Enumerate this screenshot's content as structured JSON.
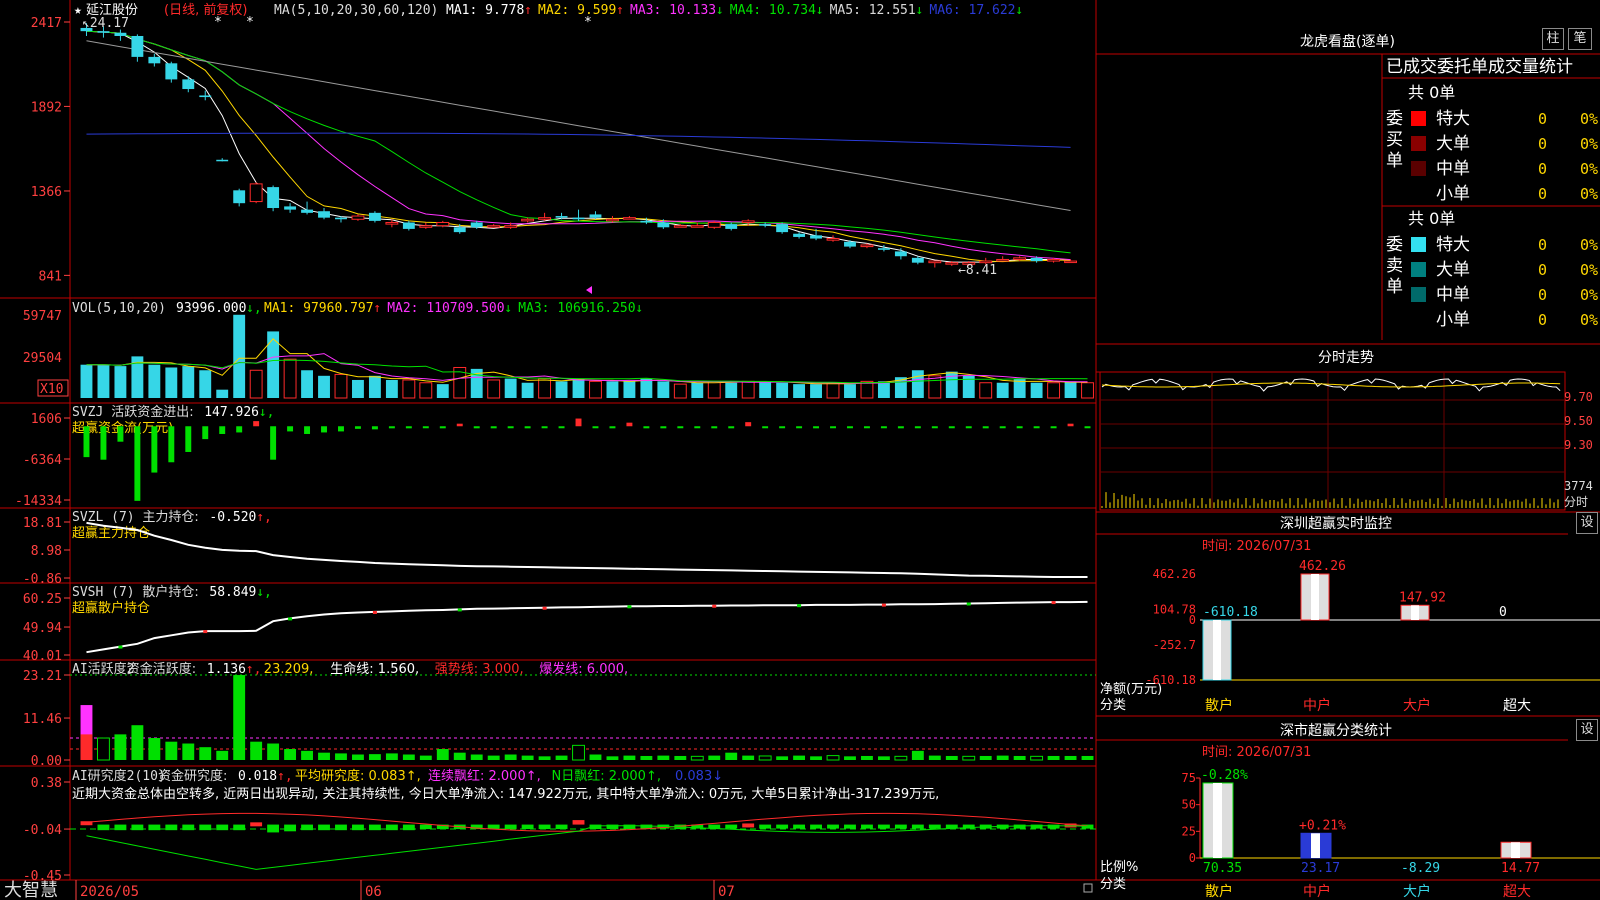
{
  "app": {
    "footer_brand": "大智慧",
    "dates": [
      "2026/05",
      "06",
      "07"
    ]
  },
  "colors": {
    "up": "#ff2a2a",
    "down": "#36d6e7",
    "grid": "#c00000",
    "axis": "#ff4040",
    "green": "#00e000",
    "yellow": "#ffd700",
    "magenta": "#ff33ff",
    "white": "#ffffff",
    "gray": "#9a9a9a",
    "blue": "#2a3bd6"
  },
  "chart_data": [
    {
      "id": "price",
      "type": "candlestick",
      "title": "延江股份",
      "subtitle": "(日线, 前复权)",
      "ma_header": "MA(5,10,20,30,60,120)",
      "ma_values": [
        {
          "label": "MA1:",
          "value": "9.778",
          "arrow": "↑",
          "color": "#ffffff"
        },
        {
          "label": "MA2:",
          "value": "9.599",
          "arrow": "↑",
          "color": "#ffd700"
        },
        {
          "label": "MA3:",
          "value": "10.133",
          "arrow": "↓",
          "color": "#ff33ff"
        },
        {
          "label": "MA4:",
          "value": "10.734",
          "arrow": "↓",
          "color": "#00e000"
        },
        {
          "label": "MA5:",
          "value": "12.551",
          "arrow": "↓",
          "color": "#d8d8d8"
        },
        {
          "label": "MA6:",
          "value": "17.622",
          "arrow": "↓",
          "color": "#2a3bd6"
        }
      ],
      "y_ticks": [
        "2417",
        "1892",
        "1366",
        "841"
      ],
      "ylim": [
        750,
        2417
      ],
      "high_label": "24.17",
      "low_label": "←8.41",
      "candles": [
        [
          2380,
          2360,
          2410,
          2330
        ],
        [
          2360,
          2350,
          2390,
          2320
        ],
        [
          2350,
          2330,
          2370,
          2300
        ],
        [
          2330,
          2200,
          2340,
          2170
        ],
        [
          2200,
          2160,
          2220,
          2140
        ],
        [
          2160,
          2060,
          2170,
          2040
        ],
        [
          2060,
          2000,
          2080,
          1980
        ],
        [
          1960,
          1950,
          1990,
          1930
        ],
        [
          1560,
          1555,
          1570,
          1550
        ],
        [
          1370,
          1290,
          1380,
          1270
        ],
        [
          1300,
          1410,
          1420,
          1290
        ],
        [
          1390,
          1260,
          1400,
          1240
        ],
        [
          1270,
          1250,
          1290,
          1230
        ],
        [
          1250,
          1230,
          1300,
          1220
        ],
        [
          1240,
          1200,
          1260,
          1190
        ],
        [
          1200,
          1190,
          1210,
          1170
        ],
        [
          1190,
          1210,
          1220,
          1180
        ],
        [
          1230,
          1180,
          1240,
          1170
        ],
        [
          1160,
          1170,
          1190,
          1140
        ],
        [
          1170,
          1130,
          1180,
          1120
        ],
        [
          1140,
          1150,
          1170,
          1130
        ],
        [
          1150,
          1170,
          1180,
          1140
        ],
        [
          1140,
          1110,
          1160,
          1100
        ],
        [
          1170,
          1140,
          1180,
          1130
        ],
        [
          1150,
          1150,
          1160,
          1140
        ],
        [
          1140,
          1150,
          1170,
          1130
        ],
        [
          1180,
          1190,
          1200,
          1170
        ],
        [
          1190,
          1200,
          1230,
          1180
        ],
        [
          1210,
          1200,
          1230,
          1190
        ],
        [
          1200,
          1190,
          1250,
          1180
        ],
        [
          1220,
          1200,
          1240,
          1190
        ],
        [
          1180,
          1190,
          1210,
          1170
        ],
        [
          1200,
          1200,
          1210,
          1190
        ],
        [
          1180,
          1170,
          1200,
          1160
        ],
        [
          1170,
          1140,
          1190,
          1130
        ],
        [
          1150,
          1150,
          1160,
          1140
        ],
        [
          1150,
          1150,
          1170,
          1140
        ],
        [
          1140,
          1170,
          1180,
          1130
        ],
        [
          1160,
          1130,
          1170,
          1120
        ],
        [
          1170,
          1180,
          1190,
          1150
        ],
        [
          1160,
          1150,
          1170,
          1140
        ],
        [
          1160,
          1110,
          1170,
          1100
        ],
        [
          1100,
          1080,
          1110,
          1070
        ],
        [
          1090,
          1070,
          1130,
          1060
        ],
        [
          1060,
          1070,
          1090,
          1050
        ],
        [
          1050,
          1020,
          1060,
          1010
        ],
        [
          1020,
          1030,
          1040,
          1010
        ],
        [
          1010,
          1000,
          1030,
          990
        ],
        [
          990,
          960,
          1010,
          940
        ],
        [
          950,
          920,
          960,
          910
        ],
        [
          920,
          930,
          930,
          890
        ],
        [
          920,
          920,
          930,
          900
        ],
        [
          910,
          920,
          930,
          900
        ],
        [
          920,
          930,
          950,
          910
        ],
        [
          940,
          940,
          960,
          930
        ],
        [
          940,
          950,
          960,
          930
        ],
        [
          950,
          930,
          960,
          920
        ],
        [
          930,
          940,
          950,
          920
        ],
        [
          930,
          930,
          940,
          920
        ]
      ]
    },
    {
      "id": "volume",
      "type": "bar",
      "header": "VOL(5,10,20)",
      "current": "93996.000",
      "current_arrow": "↓,",
      "ma": [
        {
          "label": "MA1:",
          "value": "97960.797",
          "arrow": "↑",
          "color": "#ffd700"
        },
        {
          "label": "MA2:",
          "value": "110709.500",
          "arrow": "↓",
          "color": "#ff33ff"
        },
        {
          "label": "MA3:",
          "value": "106916.250",
          "arrow": "↓",
          "color": "#00e000"
        }
      ],
      "y_ticks": [
        "59747",
        "29504"
      ],
      "unit_label": "X10",
      "ylim": [
        0,
        62000
      ],
      "values": [
        24000,
        24000,
        23000,
        30000,
        24000,
        22000,
        23000,
        20000,
        6000,
        60000,
        20000,
        48000,
        28000,
        20000,
        16000,
        17000,
        13000,
        16000,
        13000,
        13000,
        11000,
        10000,
        22000,
        21000,
        13000,
        14000,
        11000,
        14000,
        12000,
        14000,
        12000,
        12000,
        12000,
        14000,
        12000,
        10000,
        11000,
        12000,
        11000,
        12000,
        12000,
        11000,
        10000,
        10000,
        11000,
        10000,
        12000,
        12000,
        15000,
        20000,
        16000,
        19000,
        16000,
        11000,
        11000,
        14000,
        11000,
        11000,
        12000,
        11000
      ],
      "up": [
        false,
        false,
        false,
        false,
        false,
        false,
        false,
        false,
        false,
        false,
        true,
        false,
        true,
        false,
        false,
        true,
        false,
        false,
        false,
        true,
        true,
        false,
        true,
        false,
        true,
        false,
        false,
        true,
        false,
        false,
        true,
        false,
        false,
        false,
        false,
        true,
        false,
        true,
        false,
        true,
        false,
        false,
        false,
        false,
        true,
        false,
        true,
        false,
        false,
        false,
        true,
        false,
        false,
        true,
        false,
        false,
        false,
        true,
        false,
        true
      ]
    },
    {
      "id": "svzj",
      "type": "bar",
      "header": "SVZJ",
      "label": "活跃资金进出:",
      "current": "147.926",
      "current_arrow": "↓,",
      "sub_label": "超赢资金流(万元)",
      "y_ticks": [
        "1606",
        "-6364",
        "-14334"
      ],
      "ylim": [
        -14334,
        1606
      ],
      "values": [
        -6000,
        -6500,
        -3000,
        -14500,
        -9000,
        -7000,
        -5000,
        -2500,
        -1500,
        -1200,
        1000,
        -6500,
        -1000,
        -1500,
        -1200,
        -1000,
        -500,
        -600,
        -400,
        -400,
        -300,
        -400,
        500,
        -400,
        -400,
        -300,
        -400,
        -300,
        -300,
        1500,
        -300,
        -400,
        700,
        -400,
        -400,
        -300,
        -300,
        -400,
        -400,
        800,
        -300,
        -300,
        -300,
        -400,
        -300,
        -300,
        -300,
        -300,
        -400,
        -300,
        -300,
        -300,
        -300,
        -400,
        -300,
        -300,
        -300,
        -300,
        500,
        -300
      ]
    },
    {
      "id": "svzl",
      "type": "line",
      "header": "SVZL (7)",
      "label": "主力持仓:",
      "current": "-0.520",
      "current_arrow": "↑,",
      "sub_label": "超赢主力持仓",
      "y_ticks": [
        "18.81",
        "8.98",
        "-0.86"
      ],
      "ylim": [
        -0.86,
        18.81
      ],
      "values": [
        18.5,
        17.5,
        16.8,
        16,
        14,
        12.5,
        10.8,
        9.8,
        9,
        8.7,
        8.6,
        7.2,
        6.5,
        5.9,
        5.5,
        5.1,
        4.8,
        4.4,
        4.2,
        4.0,
        3.8,
        3.6,
        3.4,
        3.3,
        3.2,
        3.1,
        3.0,
        2.9,
        2.8,
        2.7,
        2.6,
        2.5,
        2.4,
        2.3,
        2.2,
        2.1,
        2.0,
        1.9,
        1.8,
        1.7,
        1.6,
        1.5,
        1.4,
        1.3,
        1.2,
        1.1,
        1.0,
        0.9,
        0.8,
        0.6,
        0.4,
        0.2,
        0.0,
        -0.1,
        -0.2,
        -0.3,
        -0.4,
        -0.5,
        -0.5,
        -0.52
      ]
    },
    {
      "id": "svsh",
      "type": "line",
      "header": "SVSH (7)",
      "label": "散户持仓:",
      "current": "58.849",
      "current_arrow": "↓,",
      "sub_label": "超赢散户持仓",
      "y_ticks": [
        "60.25",
        "49.94",
        "40.01"
      ],
      "ylim": [
        40.01,
        60.25
      ],
      "values": [
        41,
        42,
        43,
        44,
        46,
        47,
        48,
        48.5,
        48.5,
        48.5,
        48.6,
        52,
        53,
        53.8,
        54.4,
        54.8,
        55.1,
        55.3,
        55.5,
        55.7,
        55.9,
        56.0,
        56.2,
        56.4,
        56.5,
        56.6,
        56.7,
        56.8,
        56.9,
        57.0,
        57.1,
        57.2,
        57.3,
        57.3,
        57.4,
        57.4,
        57.5,
        57.5,
        57.6,
        57.6,
        57.7,
        57.7,
        57.7,
        57.8,
        57.8,
        57.8,
        57.9,
        57.9,
        58.0,
        58.0,
        58.1,
        58.2,
        58.3,
        58.4,
        58.5,
        58.6,
        58.7,
        58.8,
        58.8,
        58.85
      ]
    },
    {
      "id": "ai_active",
      "type": "bar",
      "header": "AI活跃度2",
      "label": "资金活跃度:",
      "current": "1.136",
      "current_arrow": "↑,",
      "legends": [
        {
          "text": "23.209,",
          "color": "#ffd700"
        },
        {
          "text": "生命线: 1.560,",
          "color": "#ffffff"
        },
        {
          "text": "强势线: 3.000,",
          "color": "#ff2a2a"
        },
        {
          "text": "爆发线: 6.000,",
          "color": "#ff33ff"
        }
      ],
      "y_ticks": [
        "23.21",
        "11.46",
        "0.00"
      ],
      "ylim": [
        0,
        23.21
      ],
      "values": [
        15,
        6,
        7,
        9.5,
        6,
        5,
        4.5,
        3.5,
        2.5,
        23.2,
        5,
        4.5,
        3,
        2.5,
        2,
        1.8,
        1.5,
        1.6,
        1.8,
        1.5,
        1.2,
        3,
        2,
        1.5,
        1.2,
        1.5,
        1.2,
        1,
        1.2,
        4,
        1.5,
        1,
        1.2,
        1.1,
        1.2,
        1.1,
        1,
        1.2,
        2,
        1.2,
        1.1,
        1,
        1.2,
        1,
        1.2,
        1,
        1.1,
        1,
        1,
        2.5,
        1.2,
        1.1,
        1,
        1.1,
        1.2,
        1.1,
        1,
        1.1,
        1.1,
        1.1
      ]
    },
    {
      "id": "ai_research",
      "type": "bar",
      "header": "AI研究度2(10)",
      "label": "资金研究度:",
      "current": "0.018",
      "current_arrow": "↑,",
      "legends": [
        {
          "text": "平均研究度: 0.083↑,",
          "color": "#ffd700"
        },
        {
          "text": "连续飘红: 2.000↑,",
          "color": "#ff33ff"
        },
        {
          "text": "N日飘红: 2.000↑,",
          "color": "#00e000"
        },
        {
          "text": "0.083↓",
          "color": "#2a3bd6"
        }
      ],
      "commentary": "近期大资金总体由空转多, 近两日出现异动, 关注其持续性, 今日大单净流入: 147.922万元, 其中特大单净流入: 0万元, 大单5日累计净出-317.239万元,",
      "y_ticks": [
        "0.38",
        "-0.04",
        "-0.45"
      ],
      "ylim": [
        -0.45,
        0.38
      ],
      "values": [
        0.03,
        -0.05,
        -0.05,
        -0.05,
        -0.05,
        -0.05,
        -0.05,
        -0.05,
        -0.05,
        -0.05,
        0.02,
        -0.07,
        -0.06,
        -0.05,
        -0.05,
        -0.05,
        -0.05,
        -0.05,
        -0.05,
        -0.05,
        -0.04,
        -0.04,
        -0.04,
        -0.04,
        -0.04,
        -0.04,
        -0.04,
        -0.04,
        -0.04,
        0.04,
        -0.04,
        -0.04,
        -0.04,
        -0.04,
        -0.03,
        -0.04,
        -0.03,
        -0.03,
        -0.03,
        0.01,
        -0.03,
        -0.03,
        -0.03,
        -0.03,
        -0.03,
        -0.03,
        -0.03,
        -0.03,
        -0.03,
        -0.03,
        -0.03,
        -0.03,
        -0.03,
        -0.03,
        -0.03,
        -0.03,
        -0.03,
        -0.03,
        0.01,
        -0.02
      ]
    },
    {
      "id": "intraday",
      "type": "line",
      "title": "分时走势",
      "y_ticks": [
        "9.70",
        "9.50",
        "9.30"
      ],
      "vol_tick": "3774",
      "vol_unit": "分时"
    },
    {
      "id": "sz_monitor",
      "type": "bar",
      "title": "深圳超赢实时监控",
      "time_label": "时间: 2026/07/31",
      "categories": [
        "散户",
        "中户",
        "大户",
        "超大"
      ],
      "values": [
        -610.18,
        462.26,
        147.92,
        0
      ],
      "value_labels": [
        "-610.18",
        "462.26",
        "147.92",
        "0"
      ],
      "y_ticks": [
        "462.26",
        "104.78",
        "0",
        "-252.7",
        "-610.18"
      ],
      "ylabel": "净额(万元)",
      "xlabel": "分类",
      "ylim": [
        -610.18,
        462.26
      ]
    },
    {
      "id": "sz_category",
      "type": "bar",
      "title": "深市超赢分类统计",
      "time_label": "时间: 2026/07/31",
      "categories": [
        "散户",
        "中户",
        "大户",
        "超大"
      ],
      "values": [
        70.35,
        23.17,
        -8.29,
        14.77
      ],
      "top_labels": [
        "-0.28%",
        "+0.21%",
        "",
        ""
      ],
      "y_ticks": [
        "75",
        "50",
        "25",
        "0"
      ],
      "ylabel": "比例%",
      "xlabel": "分类",
      "ylim": [
        0,
        75
      ]
    }
  ],
  "right_panel": {
    "title": "龙虎看盘(逐单)",
    "btn_zhu": "柱",
    "btn_bi": "笔",
    "tabs_text": "已成交委托单成交量统计",
    "buy": {
      "side_label": "委买单",
      "total": "共 0单",
      "rows": [
        {
          "name": "特大",
          "count": "0",
          "pct": "0%",
          "color": "#ff0000"
        },
        {
          "name": "大单",
          "count": "0",
          "pct": "0%",
          "color": "#8a0000"
        },
        {
          "name": "中单",
          "count": "0",
          "pct": "0%",
          "color": "#5a0000"
        },
        {
          "name": "小单",
          "count": "0",
          "pct": "0%",
          "color": ""
        }
      ]
    },
    "sell": {
      "side_label": "委卖单",
      "total": "共 0单",
      "rows": [
        {
          "name": "特大",
          "count": "0",
          "pct": "0%",
          "color": "#33e0f0"
        },
        {
          "name": "大单",
          "count": "0",
          "pct": "0%",
          "color": "#008080"
        },
        {
          "name": "中单",
          "count": "0",
          "pct": "0%",
          "color": "#006a6a"
        },
        {
          "name": "小单",
          "count": "0",
          "pct": "0%",
          "color": ""
        }
      ]
    },
    "settings_label": "设"
  }
}
